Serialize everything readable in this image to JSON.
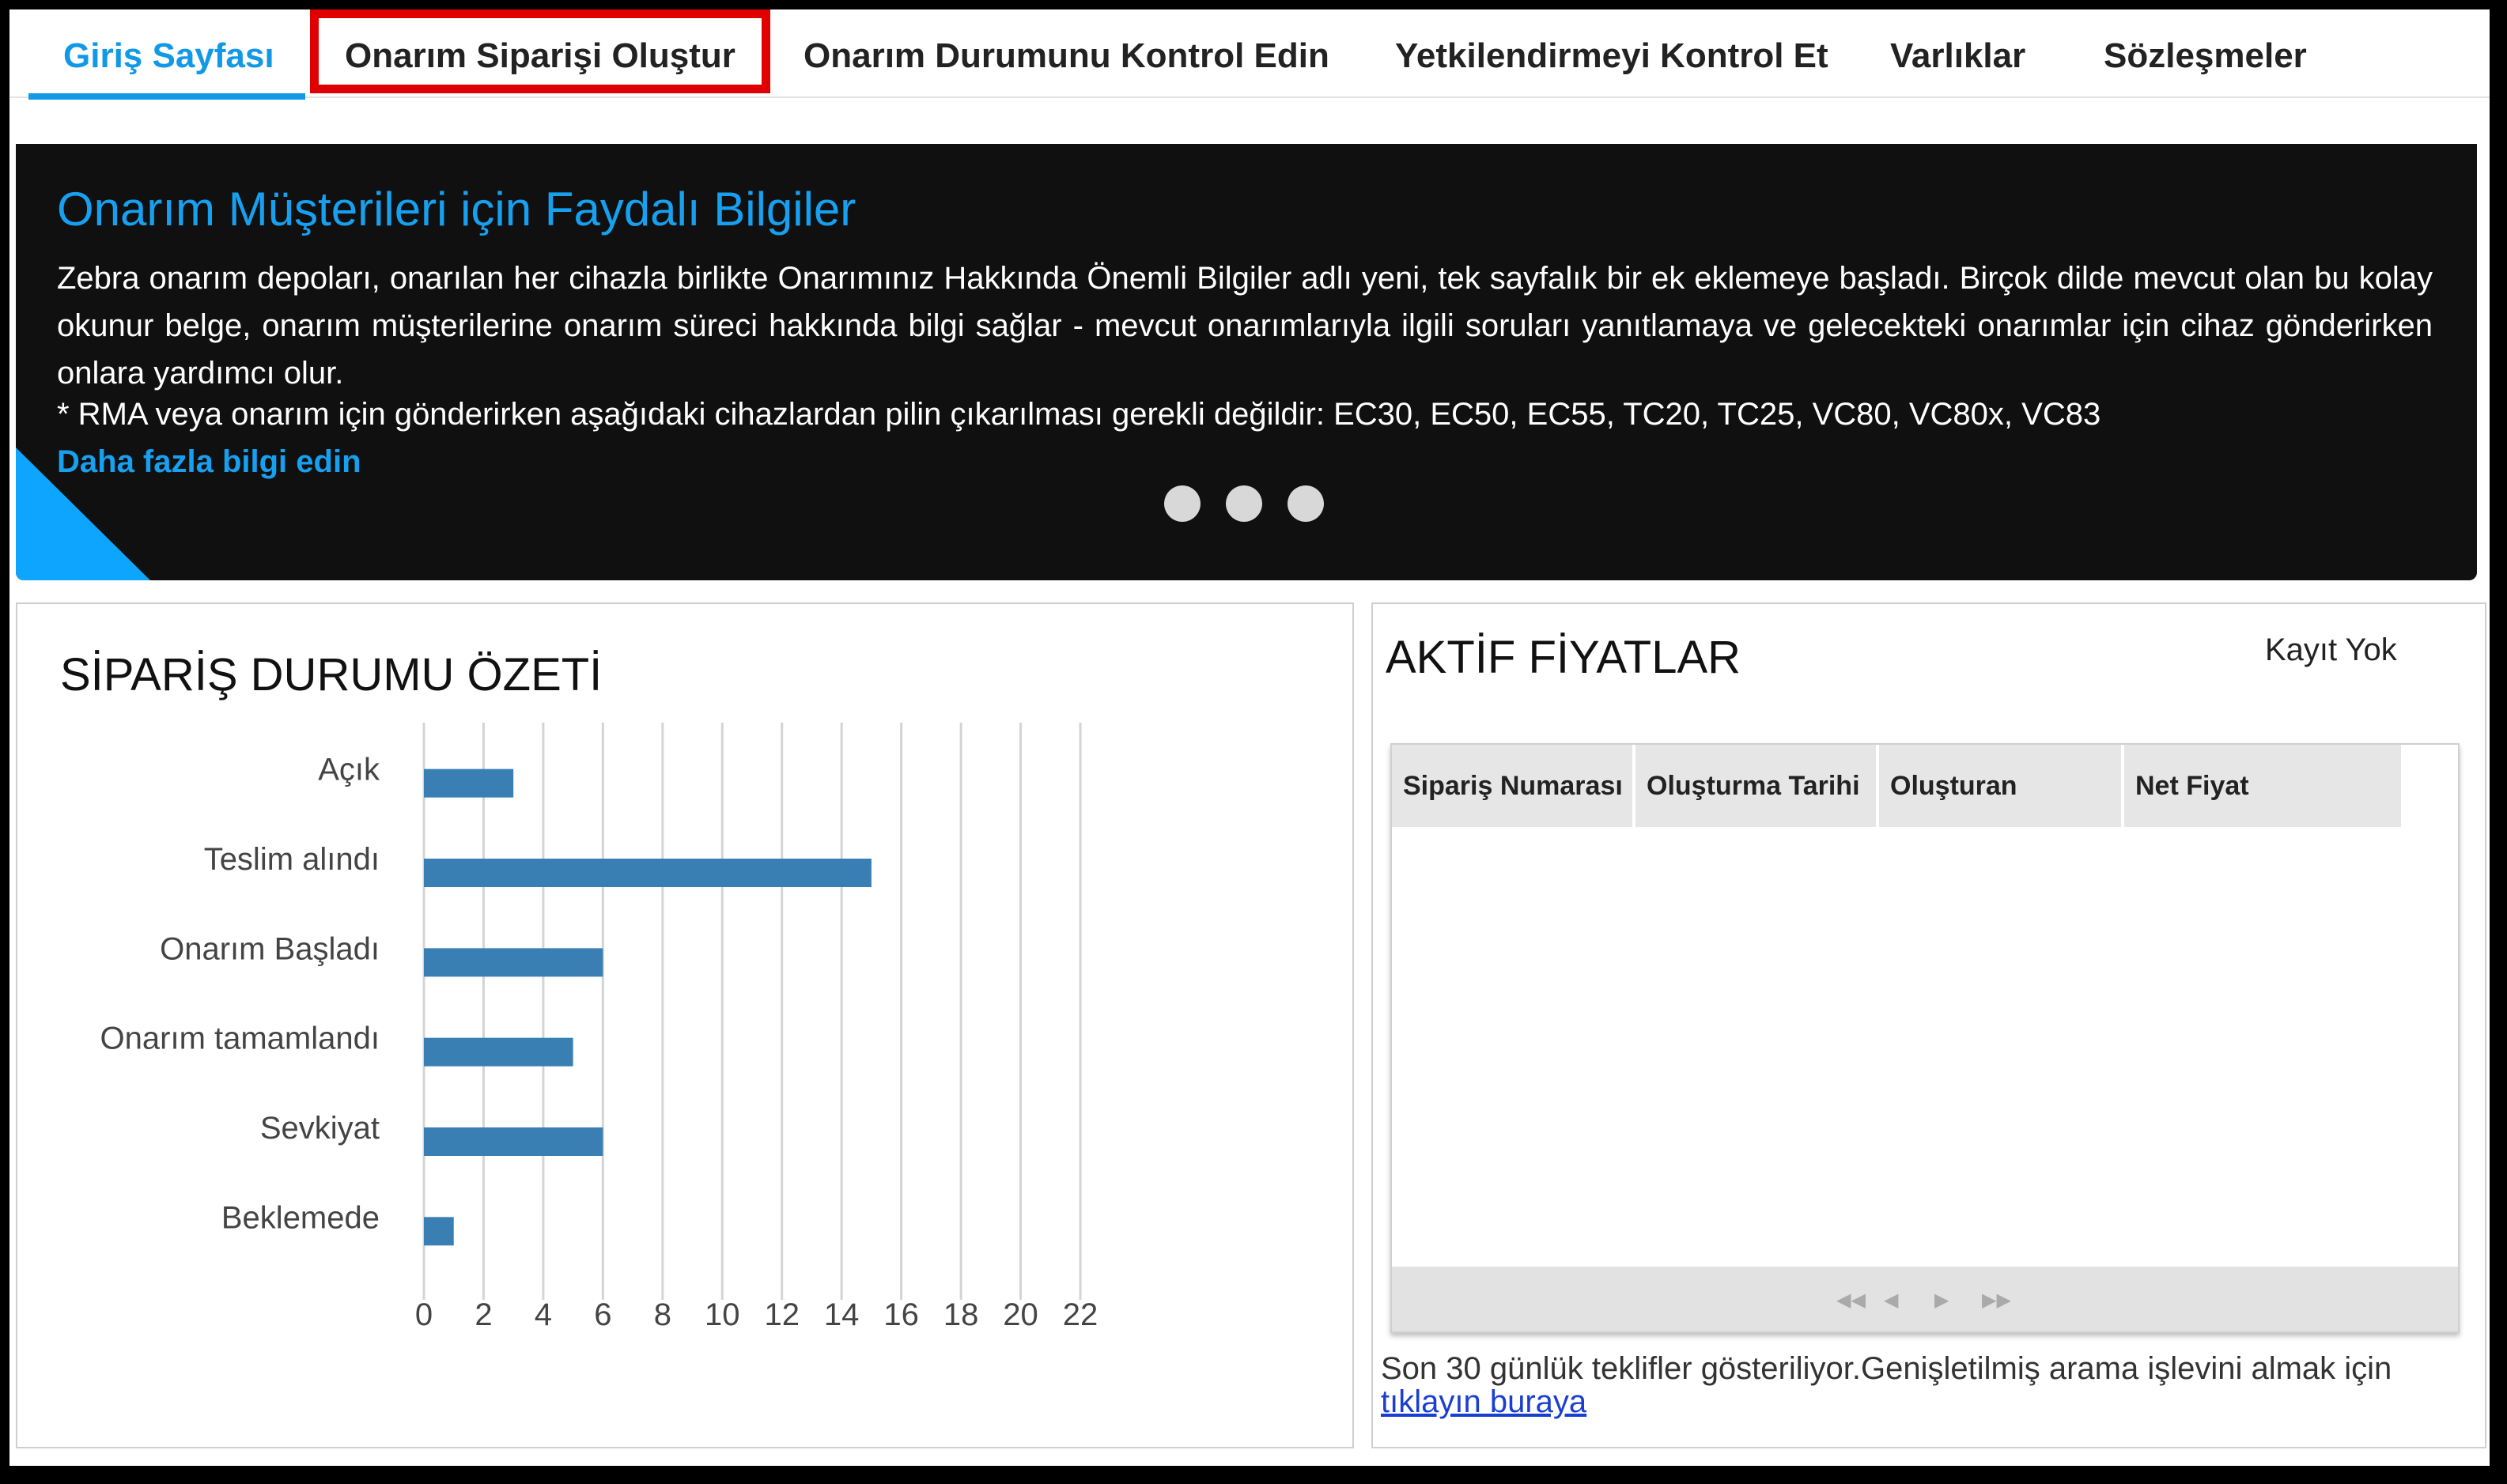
{
  "nav": {
    "tabs": [
      {
        "label": "Giriş Sayfası",
        "active": true
      },
      {
        "label": "Onarım Siparişi Oluştur",
        "highlighted": true
      },
      {
        "label": "Onarım Durumunu Kontrol Edin"
      },
      {
        "label": "Yetkilendirmeyi Kontrol Et"
      },
      {
        "label": "Varlıklar"
      },
      {
        "label": "Sözleşmeler"
      }
    ]
  },
  "banner": {
    "title": "Onarım Müşterileri için Faydalı Bilgiler",
    "body": "Zebra onarım depoları, onarılan her cihazla birlikte Onarımınız Hakkında Önemli Bilgiler adlı yeni, tek sayfalık bir ek eklemeye başladı. Birçok dilde mevcut olan bu kolay okunur belge, onarım müşterilerine onarım süreci hakkında bilgi sağlar - mevcut onarımlarıyla ilgili soruları yanıtlamaya ve gelecekteki onarımlar için cihaz gönderirken onlara yardımcı olur.",
    "note": "* RMA veya onarım için gönderirken aşağıdaki cihazlardan pilin çıkarılması gerekli değildir: EC30, EC50, EC55, TC20, TC25, VC80, VC80x, VC83",
    "link": "Daha fazla bilgi edin",
    "carousel_dots": 3
  },
  "order_summary": {
    "title": "SİPARİŞ DURUMU ÖZETİ"
  },
  "chart_data": {
    "type": "bar",
    "orientation": "horizontal",
    "title": "SİPARİŞ DURUMU ÖZETİ",
    "categories": [
      "Açık",
      "Teslim alındı",
      "Onarım Başladı",
      "Onarım tamamlandı",
      "Sevkiyat",
      "Beklemede"
    ],
    "values": [
      3,
      15,
      6,
      5,
      6,
      1
    ],
    "xlim": [
      0,
      22
    ],
    "xticks": [
      0,
      2,
      4,
      6,
      8,
      10,
      12,
      14,
      16,
      18,
      20,
      22
    ],
    "grid": true,
    "bar_color": "#3a7fb4"
  },
  "active_prices": {
    "title": "AKTİF FİYATLAR",
    "no_records": "Kayıt Yok",
    "columns": [
      "Sipariş Numarası",
      "Oluşturma Tarihi",
      "Oluşturan",
      "Net Fiyat"
    ],
    "pager_icons": [
      "first-page-icon",
      "prev-page-icon",
      "next-page-icon",
      "last-page-icon"
    ],
    "footer_text": "Son 30 günlük teklifler gösteriliyor.Genişletilmiş arama işlevini almak için",
    "footer_link": "tıklayın buraya"
  }
}
